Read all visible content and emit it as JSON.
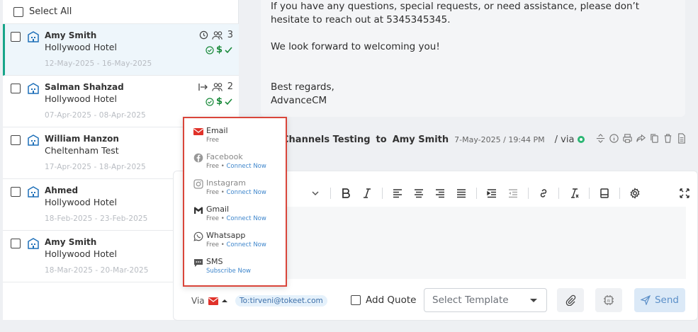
{
  "list": {
    "select_all": "Select All",
    "rows": [
      {
        "name": "Amy Smith",
        "hotel": "Hollywood Hotel",
        "dates": "12-May-2025 - 16-May-2025",
        "guests": "3"
      },
      {
        "name": "Salman Shahzad",
        "hotel": "Hollywood Hotel",
        "dates": "07-Apr-2025 - 08-Apr-2025",
        "guests": "2"
      },
      {
        "name": "William Hanzon",
        "hotel": "Cheltenham Test",
        "dates": "17-Apr-2025 - 18-Apr-2025"
      },
      {
        "name": "Ahmed",
        "hotel": "Hollywood Hotel",
        "dates": "18-Feb-2025 - 23-Feb-2025"
      },
      {
        "name": "Amy Smith",
        "hotel": "Hollywood Hotel",
        "dates": "18-Mar-2025 - 20-Mar-2025"
      }
    ]
  },
  "message": {
    "p1": "If you have any questions, special requests, or need assistance, please don’t hesitate to reach out at 5345345345.",
    "p2": "We look forward to welcoming you!",
    "p3_line1": "Best regards,",
    "p3_line2": "AdvanceCM",
    "header_from": "Channels Testing",
    "header_to": "to",
    "header_to_name": "Amy Smith",
    "header_time": "7-May-2025 / 19:44 PM",
    "header_via": "/ via"
  },
  "composer": {
    "via_label": "Via",
    "to_chip": "To:tirveni@tokeet.com",
    "add_quote": "Add Quote",
    "select_template": "Select Template",
    "send": "Send"
  },
  "channels": [
    {
      "label": "Email",
      "sub": "Free",
      "link": ""
    },
    {
      "label": "Facebook",
      "sub": "Free • ",
      "link": "Connect Now"
    },
    {
      "label": "Instagram",
      "sub": "Free • ",
      "link": "Connect Now"
    },
    {
      "label": "Gmail",
      "sub": "Free • ",
      "link": "Connect Now"
    },
    {
      "label": "Whatsapp",
      "sub": "Free • ",
      "link": "Connect Now"
    },
    {
      "label": "SMS",
      "sub": "",
      "link": "Subscribe Now"
    }
  ],
  "colors": {
    "accent": "#17a589",
    "popup_border": "#d9453a",
    "email_red": "#e0322a",
    "link": "#3e86cc",
    "money_green": "#1a8a3b"
  }
}
